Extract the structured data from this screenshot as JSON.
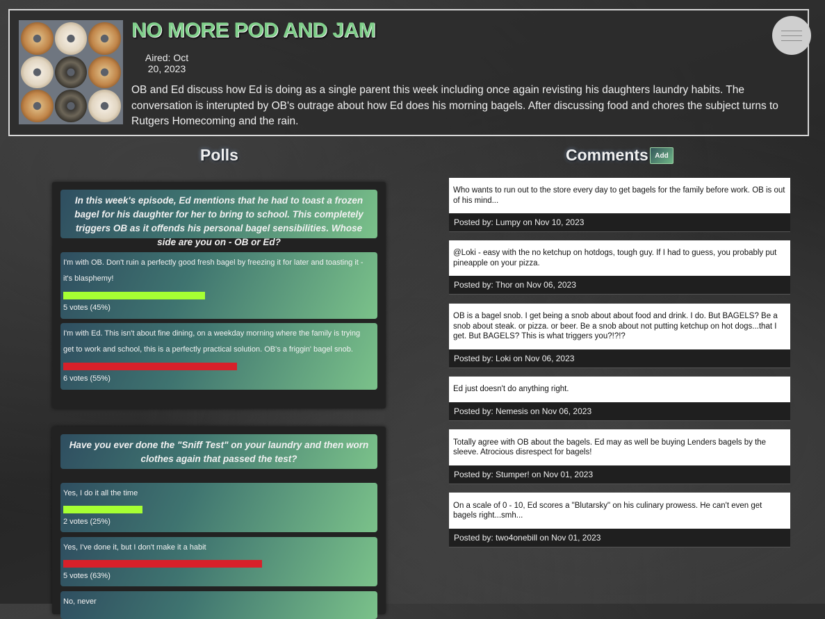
{
  "episode": {
    "title": "NO MORE POD AND JAM",
    "aired": "Aired: Oct 20, 2023",
    "description": "OB and Ed discuss how Ed is doing as a single parent this week including once again revisting his daughters laundry habits. The conversation is interupted by OB's outrage about how Ed does his morning bagels. After discussing food and chores the subject turns to Rutgers Homecoming and the rain."
  },
  "sections": {
    "polls": "Polls",
    "comments": "Comments",
    "add": "Add"
  },
  "polls": [
    {
      "question": "In this week's episode, Ed mentions that he had to toast a frozen bagel for his daughter for her to bring to school. This completely triggers OB as it offends his personal bagel sensibilities. Whose side are you on - OB or Ed?",
      "options": [
        {
          "text": "I'm with OB. Don't ruin a perfectly good fresh bagel by freezing it for later and toasting it - it's blasphemy!",
          "votes": "5 votes (45%)",
          "percent": 45,
          "color": "#a6ff33"
        },
        {
          "text": "I'm with Ed. This isn't about fine dining, on a weekday morning where the family is trying get to work and school, this is a perfectly practical solution. OB's a friggin' bagel snob.",
          "votes": "6 votes (55%)",
          "percent": 55,
          "color": "#d8202a"
        }
      ]
    },
    {
      "question": "Have you ever done the \"Sniff Test\" on your laundry and then worn clothes again that passed the test?",
      "options": [
        {
          "text": "Yes, I do it all the time",
          "votes": "2 votes (25%)",
          "percent": 25,
          "color": "#a6ff33"
        },
        {
          "text": "Yes, I've done it, but I don't make it a habit",
          "votes": "5 votes (63%)",
          "percent": 63,
          "color": "#d8202a"
        },
        {
          "text": "No, never",
          "votes": "",
          "percent": 0,
          "color": "#a6ff33"
        }
      ]
    }
  ],
  "comments": [
    {
      "text": "Who wants to run out to the store every day to get bagels for the family before work. OB is out of his mind...",
      "footer": "Posted by: Lumpy on Nov 10, 2023"
    },
    {
      "text": "@Loki - easy with the no ketchup on hotdogs, tough guy. If I had to guess, you probably put pineapple on your pizza.",
      "footer": "Posted by: Thor on Nov 06, 2023"
    },
    {
      "text": "OB is a bagel snob. I get being a snob about about food and drink. I do. But BAGELS? Be a snob about steak. or pizza. or beer. Be a snob about not putting ketchup on hot dogs...that I get. But BAGELS? This is what triggers you?!?!?",
      "footer": "Posted by: Loki on Nov 06, 2023"
    },
    {
      "text": "Ed just doesn't do anything right.",
      "footer": "Posted by: Nemesis on Nov 06, 2023"
    },
    {
      "text": "Totally agree with OB about the bagels. Ed may as well be buying Lenders bagels by the sleeve. Atrocious disrespect for bagels!",
      "footer": "Posted by: Stumper! on Nov 01, 2023"
    },
    {
      "text": "On a scale of 0 - 10, Ed scores a \"Blutarsky\" on his culinary prowess. He can't even get bagels right...smh...",
      "footer": "Posted by: two4onebill on Nov 01, 2023"
    }
  ]
}
